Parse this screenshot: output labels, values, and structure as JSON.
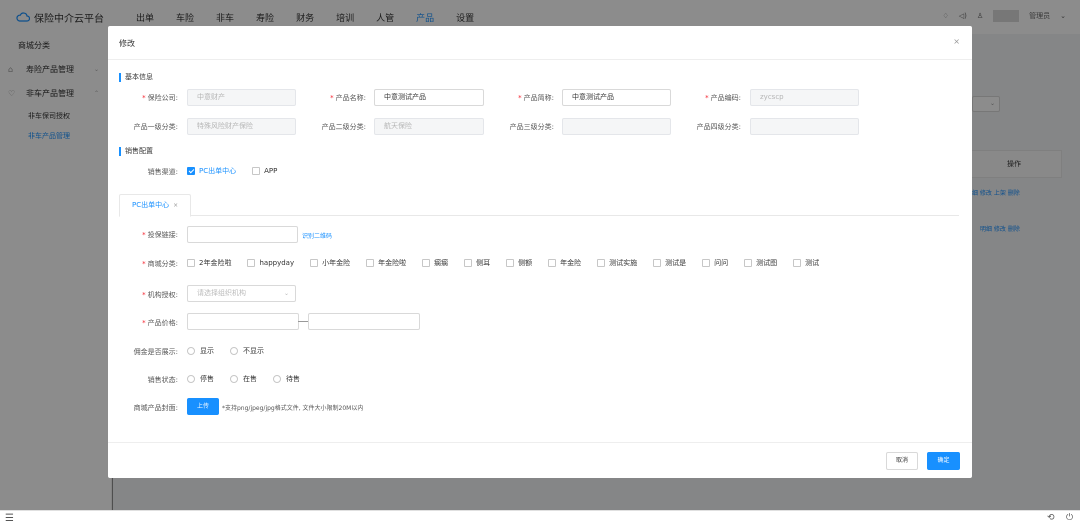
{
  "app": {
    "brand": "保险中介云平台",
    "nav": [
      "出单",
      "车险",
      "非车",
      "寿险",
      "财务",
      "培训",
      "人管",
      "产品",
      "设置"
    ],
    "nav_active_index": 7,
    "user": "管理员"
  },
  "sidebar": {
    "title": "商城分类",
    "items": [
      {
        "label": "寿险产品管理"
      },
      {
        "label": "非车产品管理"
      }
    ],
    "subitems": [
      {
        "label": "非车保司授权",
        "active": false
      },
      {
        "label": "非车产品管理",
        "active": true
      }
    ]
  },
  "background": {
    "table_header": "操作",
    "row1_ops": "明细  修改  上架  删除",
    "row2_ops": "明细  修改  删除"
  },
  "modal": {
    "title": "修改",
    "close": "×",
    "basic_section": "基本信息",
    "fields": {
      "insurer_label": "保险公司:",
      "insurer_value": "中意财产",
      "product_name_label": "产品名称:",
      "product_name_value": "中意测试产品",
      "short_name_label": "产品简称:",
      "short_name_value": "中意测试产品",
      "code_label": "产品编码:",
      "code_value": "zycscp",
      "cat1_label": "产品一级分类:",
      "cat1_value": "特殊风险财产保险",
      "cat2_label": "产品二级分类:",
      "cat2_value": "航天保险",
      "cat3_label": "产品三级分类:",
      "cat3_value": "",
      "cat4_label": "产品四级分类:",
      "cat4_value": ""
    },
    "sales_section": "销售配置",
    "channel_label": "销售渠道:",
    "channels": [
      {
        "label": "PC出单中心",
        "checked": true
      },
      {
        "label": "APP",
        "checked": false
      }
    ],
    "tab_label": "PC出单中心",
    "tab_close": "×",
    "link_label": "投保链接:",
    "link_value": "",
    "qr_link": "识别二维码",
    "category_label": "商城分类:",
    "categories": [
      "2年金险啦",
      "happyday",
      "小年金险",
      "年金险啦",
      "瘸瘸",
      "侧耳",
      "侧额",
      "年金险",
      "测试实施",
      "测试是",
      "问问",
      "测试图",
      "测试"
    ],
    "org_label": "机构授权:",
    "org_placeholder": "请选择组织机构",
    "price_label": "产品价格:",
    "price_min": "",
    "price_max": "",
    "commission_label": "佣金是否展示:",
    "commission_options": [
      "显示",
      "不显示"
    ],
    "status_label": "销售状态:",
    "status_options": [
      "停售",
      "在售",
      "待售"
    ],
    "cover_label": "商城产品封面:",
    "upload_label": "上传",
    "upload_hint": "*支持png/jpeg/jpg格式文件, 文件大小限制20M以内",
    "cancel": "取消",
    "ok": "确定"
  },
  "colors": {
    "primary": "#1890ff",
    "required": "#f5222d",
    "disabled_bg": "#f5f6f7"
  }
}
